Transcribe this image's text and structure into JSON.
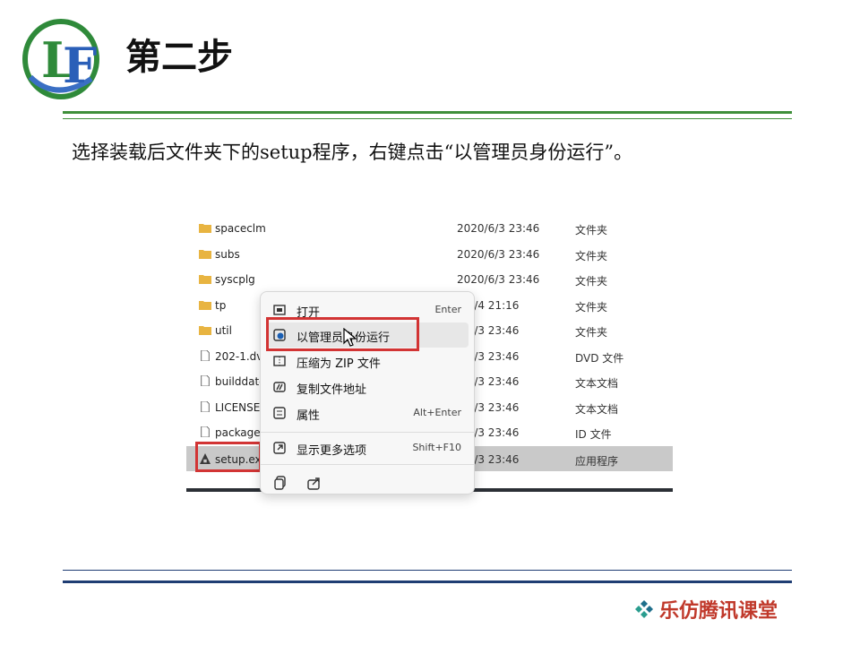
{
  "slide": {
    "title": "第二步",
    "instruction": "选择装载后文件夹下的setup程序，右键点击“以管理员身份运行”。",
    "brand": "乐仿腾讯课堂",
    "logo_letters": "LF"
  },
  "explorer": {
    "rows": [
      {
        "name": "spaceclm",
        "date": "2020/6/3 23:46",
        "type": "文件夹",
        "icon": "folder-icon"
      },
      {
        "name": "subs",
        "date": "2020/6/3 23:46",
        "type": "文件夹",
        "icon": "folder-icon"
      },
      {
        "name": "syscplg",
        "date": "2020/6/3 23:46",
        "type": "文件夹",
        "icon": "folder-icon"
      },
      {
        "name": "tp",
        "date": "0/6/4 21:16",
        "type": "文件夹",
        "icon": "folder-icon"
      },
      {
        "name": "util",
        "date": "0/6/3 23:46",
        "type": "文件夹",
        "icon": "folder-icon"
      },
      {
        "name": "202-1.dvd",
        "date": "0/6/3 23:46",
        "type": "DVD 文件",
        "icon": "file-icon"
      },
      {
        "name": "builddate",
        "date": "0/6/3 23:46",
        "type": "文本文档",
        "icon": "file-icon"
      },
      {
        "name": "LICENSE.T",
        "date": "0/6/3 23:46",
        "type": "文本文档",
        "icon": "file-icon"
      },
      {
        "name": "package.i",
        "date": "0/6/3 23:46",
        "type": "ID 文件",
        "icon": "file-icon"
      },
      {
        "name": "setup.exe",
        "date": "0/6/3 23:46",
        "type": "应用程序",
        "icon": "app-icon"
      }
    ]
  },
  "context_menu": {
    "items": [
      {
        "label": "打开",
        "shortcut": "Enter",
        "icon": "open-icon"
      },
      {
        "label": "以管理员身份运行",
        "shortcut": "",
        "icon": "shield-icon"
      },
      {
        "label": "压缩为 ZIP 文件",
        "shortcut": "",
        "icon": "zip-icon"
      },
      {
        "label": "复制文件地址",
        "shortcut": "",
        "icon": "copy-path-icon"
      },
      {
        "label": "属性",
        "shortcut": "Alt+Enter",
        "icon": "properties-icon"
      },
      {
        "label": "显示更多选项",
        "shortcut": "Shift+F10",
        "icon": "more-options-icon"
      }
    ],
    "bottom_icons": [
      "copy-icon",
      "share-icon"
    ]
  },
  "colors": {
    "green_rule": "#3f8f3a",
    "blue_rule": "#1f3d73",
    "highlight_red": "#d23434",
    "brand_red": "#c0392b"
  }
}
